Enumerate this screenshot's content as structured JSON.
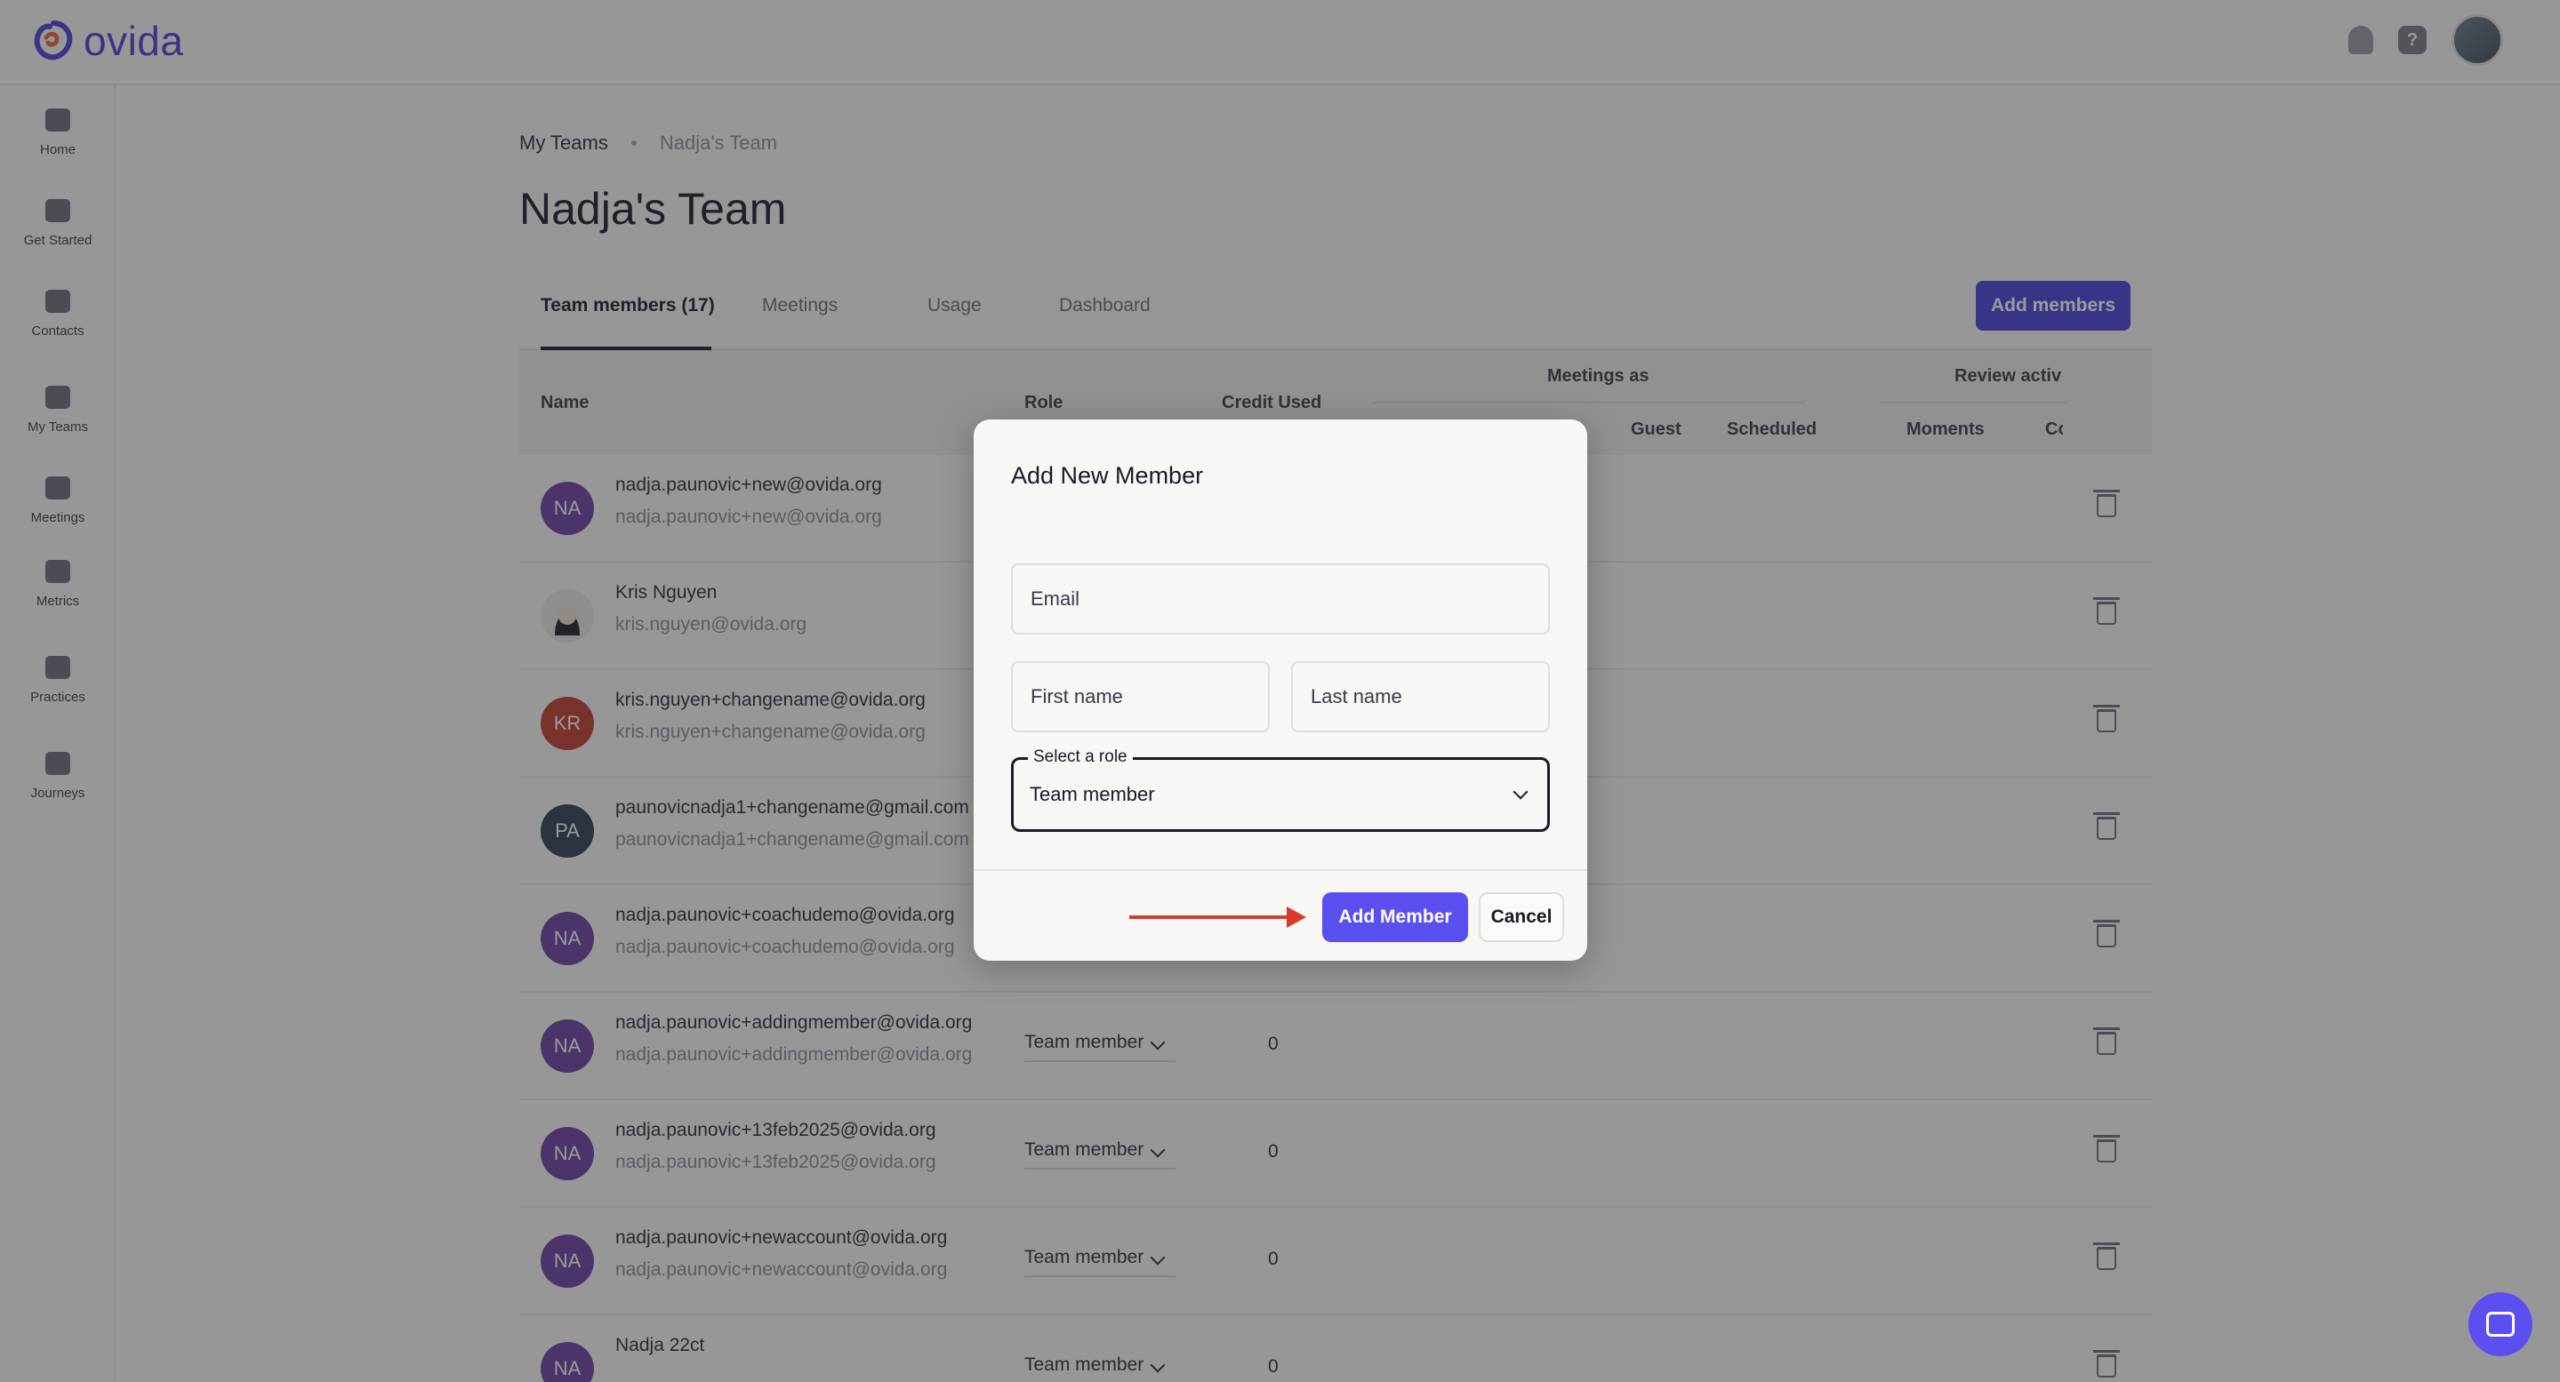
{
  "app": {
    "logo_text": "ovida"
  },
  "sidebar": {
    "items": [
      {
        "label": "Home",
        "icon": "home-icon"
      },
      {
        "label": "Get Started",
        "icon": "rocket-icon"
      },
      {
        "label": "Contacts",
        "icon": "contacts-icon"
      },
      {
        "label": "My Teams",
        "icon": "teams-icon"
      },
      {
        "label": "Meetings",
        "icon": "calendar-icon"
      },
      {
        "label": "Metrics",
        "icon": "chart-icon"
      },
      {
        "label": "Practices",
        "icon": "video-icon"
      },
      {
        "label": "Journeys",
        "icon": "route-icon"
      }
    ]
  },
  "breadcrumb": {
    "root": "My Teams",
    "current": "Nadja's Team"
  },
  "page": {
    "title": "Nadja's Team"
  },
  "tabs": [
    "Team members (17)",
    "Meetings",
    "Usage",
    "Dashboard"
  ],
  "add_members_label": "Add members",
  "table": {
    "headers": {
      "name": "Name",
      "role": "Role",
      "credit": "Credit Used",
      "meetings_as": "Meetings as",
      "guest": "Guest",
      "scheduled": "Scheduled",
      "review": "Review activ",
      "moments": "Moments",
      "c": "Co"
    },
    "rows": [
      {
        "initials": "NA",
        "color": "#6b3fa0",
        "name": "nadja.paunovic+new@ovida.org",
        "email": "nadja.paunovic+new@ovida.org",
        "role": "",
        "credit": ""
      },
      {
        "initials": "",
        "color": "#d8d6d2",
        "name": "Kris Nguyen",
        "email": "kris.nguyen@ovida.org",
        "role": "",
        "credit": ""
      },
      {
        "initials": "KR",
        "color": "#c0392b",
        "name": "kris.nguyen+changename@ovida.org",
        "email": "kris.nguyen+changename@ovida.org",
        "role": "",
        "credit": ""
      },
      {
        "initials": "PA",
        "color": "#2c3e50",
        "name": "paunovicnadja1+changename@gmail.com",
        "email": "paunovicnadja1+changename@gmail.com",
        "role": "",
        "credit": ""
      },
      {
        "initials": "NA",
        "color": "#6b3fa0",
        "name": "nadja.paunovic+coachudemo@ovida.org",
        "email": "nadja.paunovic+coachudemo@ovida.org",
        "role": "",
        "credit": ""
      },
      {
        "initials": "NA",
        "color": "#6b3fa0",
        "name": "nadja.paunovic+addingmember@ovida.org",
        "email": "nadja.paunovic+addingmember@ovida.org",
        "role": "Team member",
        "credit": "0"
      },
      {
        "initials": "NA",
        "color": "#6b3fa0",
        "name": "nadja.paunovic+13feb2025@ovida.org",
        "email": "nadja.paunovic+13feb2025@ovida.org",
        "role": "Team member",
        "credit": "0"
      },
      {
        "initials": "NA",
        "color": "#6b3fa0",
        "name": "nadja.paunovic+newaccount@ovida.org",
        "email": "nadja.paunovic+newaccount@ovida.org",
        "role": "Team member",
        "credit": "0"
      },
      {
        "initials": "NA",
        "color": "#6b3fa0",
        "name": "Nadja 22ct",
        "email": "",
        "role": "Team member",
        "credit": "0"
      }
    ]
  },
  "modal": {
    "title": "Add New Member",
    "email_placeholder": "Email",
    "first_name_placeholder": "First name",
    "last_name_placeholder": "Last name",
    "role_legend": "Select a role",
    "role_value": "Team member",
    "submit_label": "Add Member",
    "cancel_label": "Cancel",
    "annotation_arrow_color": "#d93a2b"
  },
  "colors": {
    "brand": "#4a3fd6",
    "accent": "#5b4ff0"
  }
}
